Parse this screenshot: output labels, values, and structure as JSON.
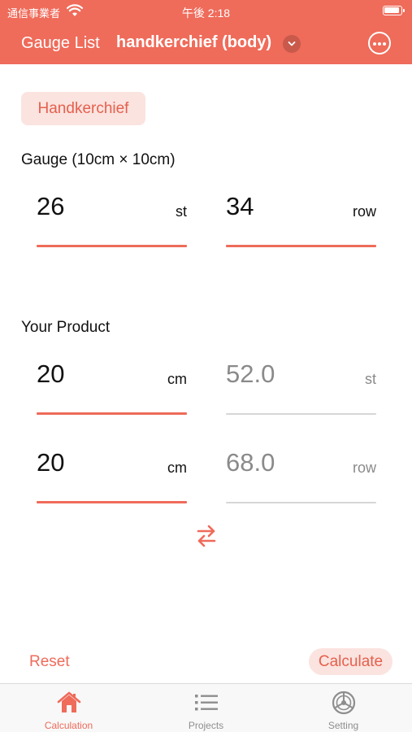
{
  "status_bar": {
    "carrier": "通信事業者",
    "time": "午後 2:18"
  },
  "nav": {
    "back_label": "Gauge List",
    "title": "handkerchief (body)"
  },
  "tag_label": "Handkerchief",
  "gauge": {
    "section_label": "Gauge (10cm × 10cm)",
    "stitches": {
      "value": "26",
      "unit": "st"
    },
    "rows": {
      "value": "34",
      "unit": "row"
    }
  },
  "product": {
    "section_label": "Your Product",
    "width": {
      "value": "20",
      "unit": "cm"
    },
    "width_result": {
      "value": "52.0",
      "unit": "st"
    },
    "length": {
      "value": "20",
      "unit": "cm"
    },
    "length_result": {
      "value": "68.0",
      "unit": "row"
    }
  },
  "actions": {
    "reset_label": "Reset",
    "calculate_label": "Calculate"
  },
  "tabs": [
    {
      "label": "Calculation",
      "icon": "home-icon",
      "active": true
    },
    {
      "label": "Projects",
      "icon": "list-icon",
      "active": false
    },
    {
      "label": "Setting",
      "icon": "settings-wheel-icon",
      "active": false
    }
  ],
  "colors": {
    "accent": "#EF6B5A",
    "accent_light": "#FBE3DF",
    "muted_text": "#8a8a8a",
    "tab_inactive": "#8e8e8e"
  }
}
